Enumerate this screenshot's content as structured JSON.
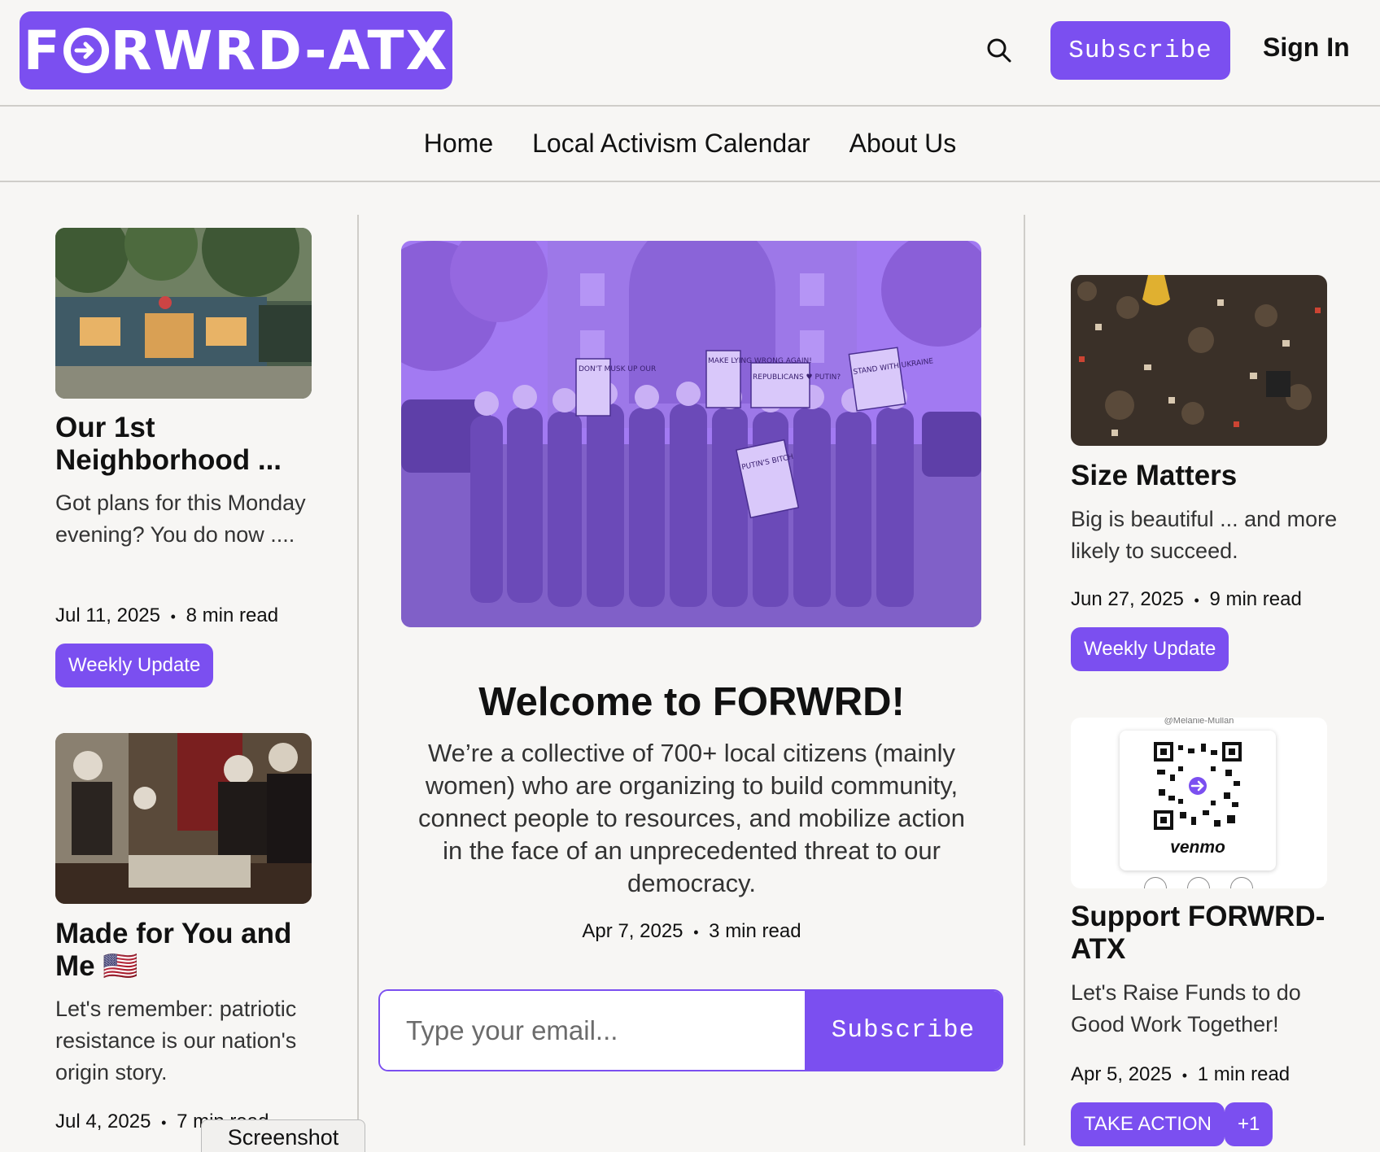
{
  "header": {
    "logo_text": "F RWRD-ATX",
    "logo_prefix": "F",
    "logo_suffix": "RWRD-ATX",
    "subscribe_label": "Subscribe",
    "sign_in_label": "Sign In"
  },
  "nav": {
    "items": [
      "Home",
      "Local Activism Calendar",
      "About Us"
    ]
  },
  "left_posts": [
    {
      "title": "Our 1st Neighborhood ...",
      "excerpt": "Got plans for this Monday evening? You do now ....",
      "date": "Jul 11, 2025",
      "read_time": "8 min read",
      "tag": "Weekly Update"
    },
    {
      "title": "Made for You and Me 🇺🇸",
      "excerpt": "Let's remember: patriotic resistance is our nation's origin story.",
      "date": "Jul 4, 2025",
      "read_time": "7 min read"
    }
  ],
  "hero": {
    "title": "Welcome to FORWRD!",
    "description": "We’re a collective of 700+ local citizens (mainly women) who are organizing to build community, connect people to resources, and mobilize action in the face of an unprecedented threat to our democracy.",
    "date": "Apr 7, 2025",
    "read_time": "3 min read",
    "email_placeholder": "Type your email...",
    "subscribe_label": "Subscribe",
    "sign_texts": [
      "DON'T MUSK UP OUR",
      "MAKE LYING WRONG AGAIN!",
      "REPUBLICANS ♥ PUTIN?",
      "STAND WITH UKRAINE",
      "PUTIN'S BITCH"
    ]
  },
  "right_posts": [
    {
      "title": "Size Matters",
      "excerpt": "Big is beautiful ... and more likely to succeed.",
      "date": "Jun 27, 2025",
      "read_time": "9 min read",
      "tag": "Weekly Update"
    },
    {
      "title": "Support FORWRD-ATX",
      "excerpt": "Let's Raise Funds to do Good Work Together!",
      "date": "Apr 5, 2025",
      "read_time": "1 min read",
      "tags": [
        "TAKE ACTION",
        "+1"
      ],
      "venmo_label": "venmo",
      "venmo_handle": "@Melanie-Mullan"
    }
  ],
  "meta_separator": "•",
  "screenshot_tab": "Screenshot",
  "colors": {
    "accent": "#7b4ff0",
    "background": "#f7f6f4",
    "divider": "#cfcdc9"
  }
}
